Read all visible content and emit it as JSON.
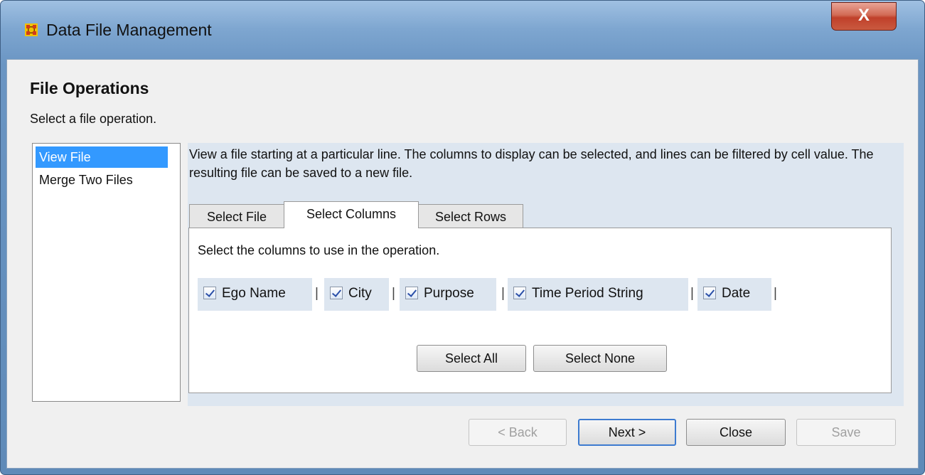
{
  "window": {
    "title": "Data File Management",
    "icon": "app-grid-icon",
    "close_label": "X"
  },
  "header": {
    "title": "File Operations",
    "subtitle": "Select a file operation."
  },
  "operations": [
    {
      "label": "View File",
      "selected": true
    },
    {
      "label": "Merge Two Files",
      "selected": false
    }
  ],
  "description": "View a file starting at a particular line. The columns to display can be selected, and lines can be filtered by cell value. The resulting file can be saved to a new file.",
  "tabs": [
    {
      "label": "Select File",
      "active": false
    },
    {
      "label": "Select Columns",
      "active": true
    },
    {
      "label": "Select Rows",
      "active": false
    }
  ],
  "columns_panel": {
    "instruction": "Select the columns to use in the operation.",
    "columns": [
      {
        "label": "Ego Name",
        "checked": true
      },
      {
        "label": "City",
        "checked": true
      },
      {
        "label": "Purpose",
        "checked": true
      },
      {
        "label": "Time Period String",
        "checked": true
      },
      {
        "label": "Date",
        "checked": true
      }
    ],
    "separator": "|",
    "select_all_label": "Select All",
    "select_none_label": "Select None"
  },
  "footer": {
    "back_label": "< Back",
    "next_label": "Next >",
    "close_label": "Close",
    "save_label": "Save"
  },
  "colors": {
    "selection": "#3399ff",
    "title_bar": "#7ea6d0",
    "close_button": "#c95a40"
  }
}
